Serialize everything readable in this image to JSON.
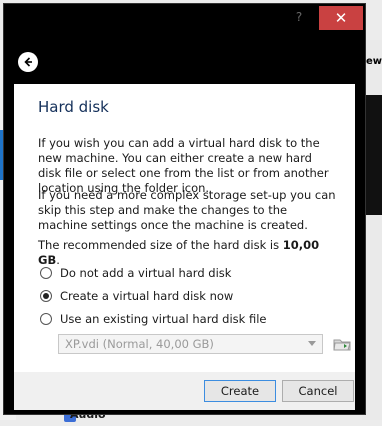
{
  "background": {
    "right_text": "ew",
    "audio_label": "Audio"
  },
  "dialog": {
    "help_label": "?",
    "close_label": "✕",
    "heading": "Hard disk",
    "paragraph1": "If you wish you can add a virtual hard disk to the new machine. You can either create a new hard disk file or select one from the list or from another location using the folder icon.",
    "paragraph2": "If you need a more complex storage set-up you can skip this step and make the changes to the machine settings once the machine is created.",
    "recommended_prefix": "The recommended size of the hard disk is ",
    "recommended_value": "10,00 GB",
    "recommended_suffix": ".",
    "options": [
      {
        "label": "Do not add a virtual hard disk",
        "checked": false
      },
      {
        "label": "Create a virtual hard disk now",
        "checked": true
      },
      {
        "label": "Use an existing virtual hard disk file",
        "checked": false
      }
    ],
    "existing_file_value": "XP.vdi (Normal, 40,00 GB)",
    "create_label": "Create",
    "cancel_label": "Cancel"
  },
  "colors": {
    "close_bg": "#c94141",
    "heading": "#14305a",
    "primary_border": "#3c8de0"
  }
}
